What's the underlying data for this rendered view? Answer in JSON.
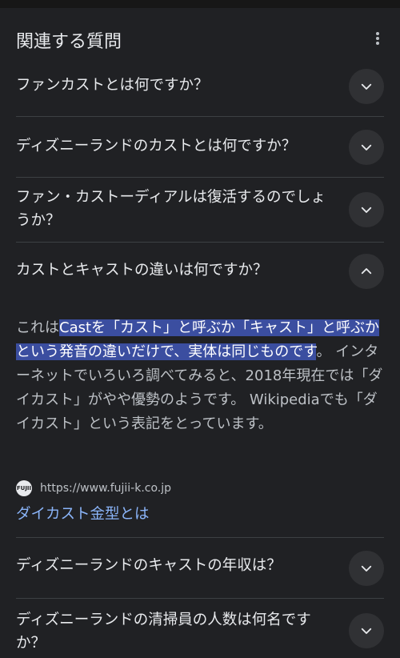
{
  "section": {
    "title": "関連する質問",
    "menu_icon": "kebab-icon"
  },
  "questions": [
    {
      "label": "ファンカストとは何ですか？",
      "icon": "chevron-down-icon"
    },
    {
      "label": "ディズニーランドのカストとは何ですか？",
      "icon": "chevron-down-icon"
    },
    {
      "label": "ファン・カストーディアルは復活するのでしょうか？",
      "icon": "chevron-down-icon"
    },
    {
      "label": "カストとキャストの違いは何ですか？",
      "icon": "chevron-up-icon"
    },
    {
      "label": "ディズニーランドのキャストの年収は？",
      "icon": "chevron-down-icon"
    },
    {
      "label": "ディズニーランドの清掃員の人数は何名ですか？",
      "icon": "chevron-down-icon"
    }
  ],
  "answer": {
    "prefix": "これは",
    "highlight": "Castを「カスト」と呼ぶか「キャスト」と呼ぶかという発音の違いだけで、実体は同じものです",
    "suffix": "。 インターネットでいろいろ調べてみると、2018年現在では「ダイカスト」がやや優勢のようです。 Wikipediaでも「ダイカスト」という表記をとっています。",
    "source_favicon_text": "FUJII",
    "source_url": "https://www.fujii-k.co.jp",
    "source_title": "ダイカスト金型とは"
  },
  "colors": {
    "background": "#202124",
    "highlight": "#3b4ea0",
    "link": "#8ab4f8"
  }
}
